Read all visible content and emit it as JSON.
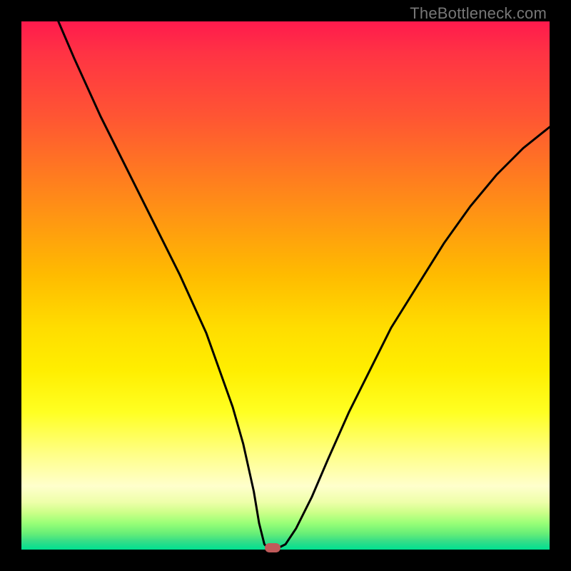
{
  "watermark": "TheBottleneck.com",
  "chart_data": {
    "type": "line",
    "title": "",
    "xlabel": "",
    "ylabel": "",
    "xlim": [
      0,
      100
    ],
    "ylim": [
      0,
      100
    ],
    "series": [
      {
        "name": "curve",
        "x": [
          7,
          10,
          15,
          20,
          25,
          30,
          35,
          40,
          42,
          44,
          45,
          46,
          47,
          48,
          50,
          52,
          55,
          58,
          62,
          66,
          70,
          75,
          80,
          85,
          90,
          95,
          100
        ],
        "y": [
          100,
          93,
          82,
          72,
          62,
          52,
          41,
          27,
          20,
          11,
          5,
          1,
          0,
          0,
          1,
          4,
          10,
          17,
          26,
          34,
          42,
          50,
          58,
          65,
          71,
          76,
          80
        ]
      }
    ],
    "marker": {
      "x": 47.5,
      "y": 0,
      "color": "#c05a5a"
    },
    "gradient_stops": [
      {
        "pos": 0,
        "color": "#ff1a4d"
      },
      {
        "pos": 50,
        "color": "#ffdd00"
      },
      {
        "pos": 100,
        "color": "#00e090"
      }
    ]
  }
}
